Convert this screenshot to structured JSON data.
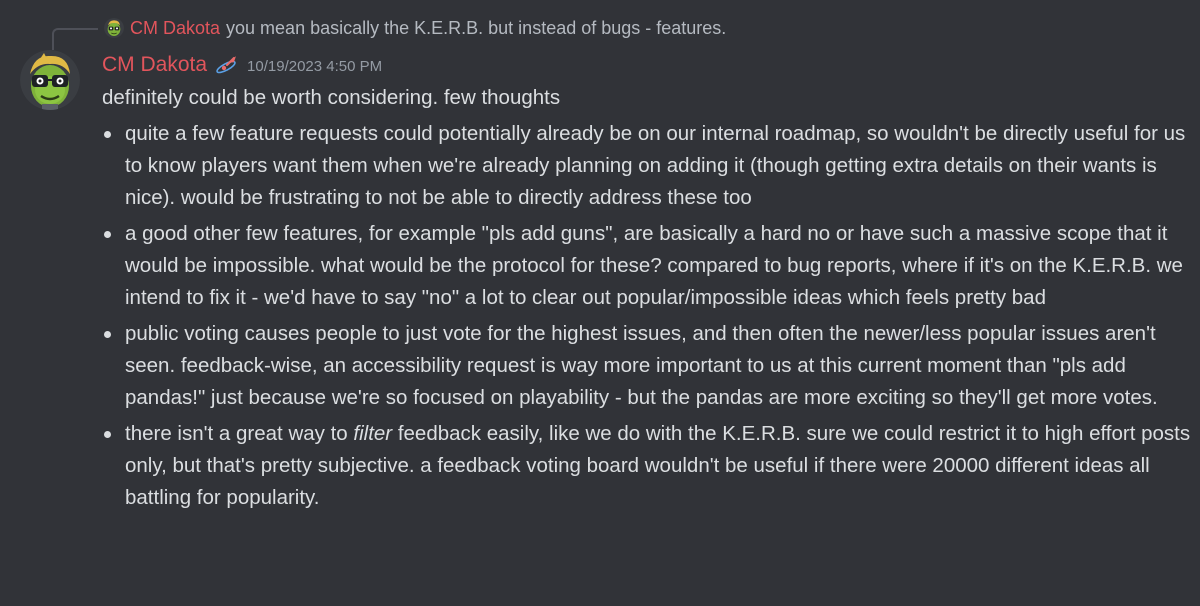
{
  "reply": {
    "author": "CM Dakota",
    "text": "you mean basically the K.E.R.B. but instead of bugs - features."
  },
  "message": {
    "author": "CM Dakota",
    "timestamp": "10/19/2023 4:50 PM",
    "role_icon": "planet-rocket-icon",
    "intro": "definitely could be worth considering. few thoughts",
    "bullets": [
      "quite a few feature requests could potentially already be on our internal roadmap, so wouldn't be directly useful for us to know players want them when we're already planning on adding it (though getting extra details on their wants is nice). would be frustrating to not be able to directly address these too",
      "a good other few features, for example \"pls add guns\", are basically a hard no or have such a massive scope that it would be impossible. what would be the protocol for these? compared to bug reports, where if it's on the K.E.R.B. we intend to fix it - we'd have to say \"no\" a lot to clear out popular/impossible ideas which feels pretty bad",
      "public voting causes people to just vote for the highest issues, and then often the newer/less popular issues aren't seen. feedback-wise, an accessibility request is way more important to us at this current moment than \"pls add pandas!\" just because we're so focused on playability - but the pandas are more exciting so they'll get more votes."
    ],
    "last_bullet": {
      "before": "there isn't a great way to ",
      "emphasis": "filter",
      "after": " feedback easily, like we do with the K.E.R.B. sure we could restrict it to high effort posts only, but that's pretty subjective. a feedback voting board wouldn't be useful if there were 20000 different ideas all battling for popularity."
    }
  },
  "colors": {
    "background": "#313338",
    "author": "#e2555c",
    "text": "#dbdee1",
    "muted": "#949ba4",
    "reply_text": "#b5bac1"
  }
}
